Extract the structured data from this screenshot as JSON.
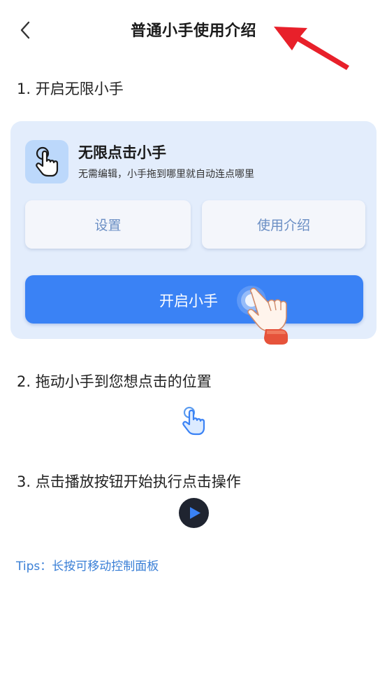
{
  "header": {
    "title": "普通小手使用介绍",
    "back_icon": "chevron-left-icon",
    "annotation_arrow_color": "#e8202a"
  },
  "steps": [
    {
      "label": "1. 开启无限小手"
    },
    {
      "label": "2. 拖动小手到您想点击的位置"
    },
    {
      "label": "3. 点击播放按钮开始执行点击操作"
    }
  ],
  "card": {
    "icon": "tap-hand-icon",
    "title": "无限点击小手",
    "subtitle": "无需编辑，小手拖到哪里就自动连点哪里",
    "settings_label": "设置",
    "intro_label": "使用介绍",
    "start_label": "开启小手",
    "background_color": "#e3edfc",
    "accent_color": "#3a82f5"
  },
  "tips": {
    "text": "Tips：长按可移动控制面板",
    "color": "#3a7fd6"
  }
}
